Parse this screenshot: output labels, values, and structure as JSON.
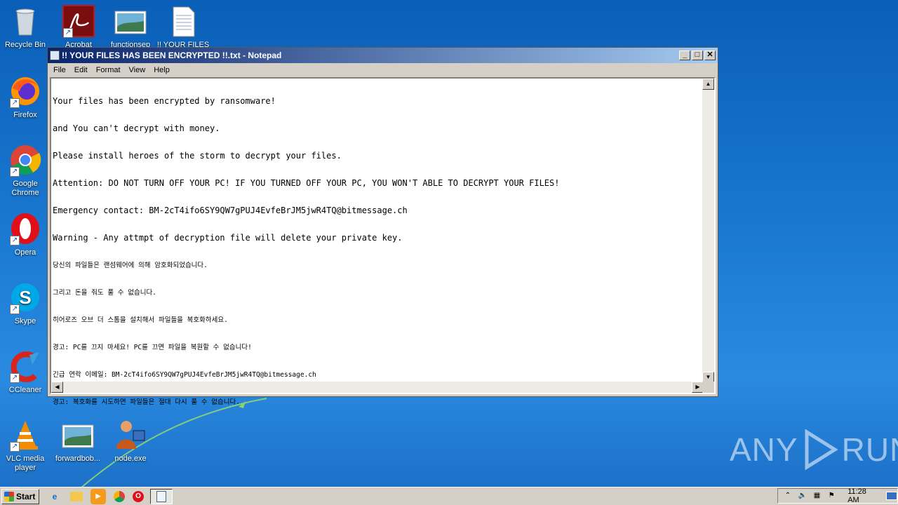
{
  "desktop": {
    "icons": [
      {
        "label": "Recycle Bin",
        "icon": "recycle-bin-icon"
      },
      {
        "label": "Acrobat",
        "icon": "acrobat-icon"
      },
      {
        "label": "functionsep",
        "icon": "image-file-icon"
      },
      {
        "label": "!! YOUR FILES",
        "icon": "text-file-icon"
      },
      {
        "label": "Firefox",
        "icon": "firefox-icon"
      },
      {
        "label": "Google Chrome",
        "icon": "chrome-icon"
      },
      {
        "label": "Opera",
        "icon": "opera-icon"
      },
      {
        "label": "Skype",
        "icon": "skype-icon"
      },
      {
        "label": "CCleaner",
        "icon": "ccleaner-icon"
      },
      {
        "label": "VLC media player",
        "icon": "vlc-icon"
      },
      {
        "label": "forwardbob...",
        "icon": "image-file-icon"
      },
      {
        "label": "node.exe",
        "icon": "node-exe-icon"
      }
    ],
    "watermark": "ANY RUN"
  },
  "notepad": {
    "title": "!! YOUR FILES HAS BEEN ENCRYPTED !!.txt - Notepad",
    "controls": {
      "minimize": "_",
      "maximize": "□",
      "close": "✕"
    },
    "menu": [
      "File",
      "Edit",
      "Format",
      "View",
      "Help"
    ],
    "lines": [
      "Your files has been encrypted by ransomware!",
      "and You can't decrypt with money.",
      "Please install heroes of the storm to decrypt your files.",
      "Attention: DO NOT TURN OFF YOUR PC! IF YOU TURNED OFF YOUR PC, YOU WON'T ABLE TO DECRYPT YOUR FILES!",
      "Emergency contact: BM-2cT4ifo6SY9QW7gPUJ4EvfeBrJM5jwR4TQ@bitmessage.ch",
      "Warning - Any attmpt of decryption file will delete your private key."
    ],
    "lines_ko": [
      "당신의 파일들은 랜섬웨어에 의해 암호화되었습니다.",
      "그리고 돈을 줘도 풀 수 없습니다.",
      "히어로즈 오브 더 스톰을 설치해서 파일들을 복호화하세요.",
      "경고: PC를 끄지 마세요! PC를 끄면 파일을 복원할 수 없습니다!",
      "긴급 연락 이메일: BM-2cT4ifo6SY9QW7gPUJ4EvfeBrJM5jwR4TQ@bitmessage.ch",
      "경고: 복호화를 시도하면 파일들은 절대 다시 풀 수 없습니다."
    ]
  },
  "taskbar": {
    "start_label": "Start",
    "quick_launch": [
      "internet-explorer-icon",
      "folder-icon",
      "media-player-icon",
      "chrome-icon",
      "opera-icon"
    ],
    "active_task": "notepad-icon",
    "clock": "11:28 AM"
  }
}
